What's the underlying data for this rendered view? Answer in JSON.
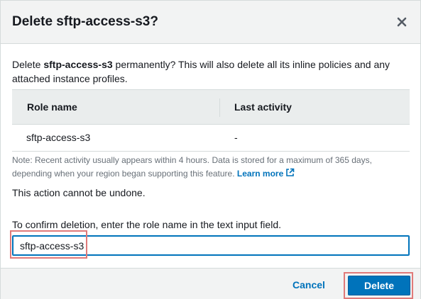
{
  "dialog": {
    "title": "Delete sftp-access-s3?",
    "close_icon": "close-icon"
  },
  "description": {
    "prefix": "Delete ",
    "role_bold": "sftp-access-s3",
    "suffix": " permanently? This will also delete all its inline policies and any attached instance profiles."
  },
  "table": {
    "columns": [
      "Role name",
      "Last activity"
    ],
    "rows": [
      {
        "role_name": "sftp-access-s3",
        "last_activity": "-"
      }
    ]
  },
  "note": {
    "text": "Note: Recent activity usually appears within 4 hours. Data is stored for a maximum of 365 days, depending when your region began supporting this feature.",
    "link": "Learn more",
    "link_icon": "external-link-icon"
  },
  "undone_text": "This action cannot be undone.",
  "confirm": {
    "label": "To confirm deletion, enter the role name in the text input field.",
    "value": "sftp-access-s3"
  },
  "footer": {
    "cancel_label": "Cancel",
    "delete_label": "Delete"
  },
  "colors": {
    "accent": "#0073bb",
    "highlight": "#e07a7a"
  }
}
